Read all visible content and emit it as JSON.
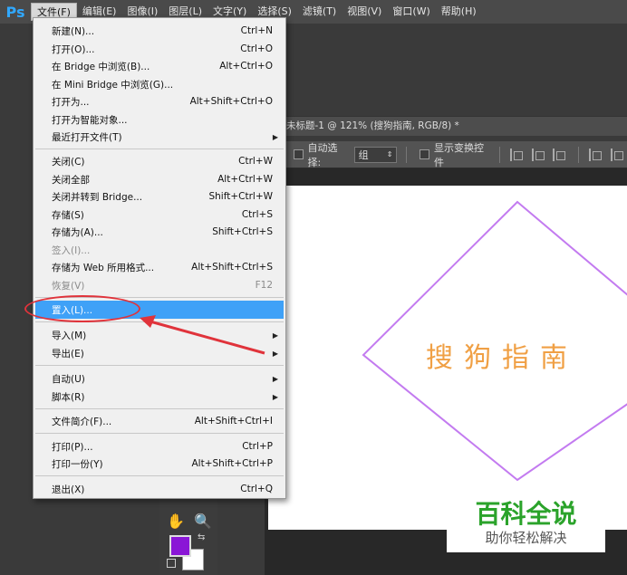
{
  "menubar": {
    "logo": "Ps",
    "items": [
      "文件(F)",
      "编辑(E)",
      "图像(I)",
      "图层(L)",
      "文字(Y)",
      "选择(S)",
      "滤镜(T)",
      "视图(V)",
      "窗口(W)",
      "帮助(H)"
    ]
  },
  "document": {
    "tab_title": "未标题-1 @ 121% (搜狗指南, RGB/8) *",
    "canvas_text": "搜狗指南"
  },
  "options": {
    "auto_select_label": "自动选择:",
    "auto_select_value": "组",
    "show_transform_label": "显示变换控件"
  },
  "file_menu": [
    {
      "label": "新建(N)...",
      "shortcut": "Ctrl+N"
    },
    {
      "label": "打开(O)...",
      "shortcut": "Ctrl+O"
    },
    {
      "label": "在 Bridge 中浏览(B)...",
      "shortcut": "Alt+Ctrl+O"
    },
    {
      "label": "在 Mini Bridge 中浏览(G)...",
      "shortcut": ""
    },
    {
      "label": "打开为...",
      "shortcut": "Alt+Shift+Ctrl+O"
    },
    {
      "label": "打开为智能对象...",
      "shortcut": ""
    },
    {
      "label": "最近打开文件(T)",
      "shortcut": "",
      "submenu": true
    },
    {
      "label": "关闭(C)",
      "shortcut": "Ctrl+W"
    },
    {
      "label": "关闭全部",
      "shortcut": "Alt+Ctrl+W"
    },
    {
      "label": "关闭并转到 Bridge...",
      "shortcut": "Shift+Ctrl+W"
    },
    {
      "label": "存储(S)",
      "shortcut": "Ctrl+S"
    },
    {
      "label": "存储为(A)...",
      "shortcut": "Shift+Ctrl+S"
    },
    {
      "label": "签入(I)...",
      "shortcut": "",
      "disabled": true
    },
    {
      "label": "存储为 Web 所用格式...",
      "shortcut": "Alt+Shift+Ctrl+S"
    },
    {
      "label": "恢复(V)",
      "shortcut": "F12",
      "disabled": true
    },
    {
      "label": "置入(L)...",
      "shortcut": "",
      "highlighted": true
    },
    {
      "label": "导入(M)",
      "shortcut": "",
      "submenu": true
    },
    {
      "label": "导出(E)",
      "shortcut": "",
      "submenu": true
    },
    {
      "label": "自动(U)",
      "shortcut": "",
      "submenu": true
    },
    {
      "label": "脚本(R)",
      "shortcut": "",
      "submenu": true
    },
    {
      "label": "文件简介(F)...",
      "shortcut": "Alt+Shift+Ctrl+I"
    },
    {
      "label": "打印(P)...",
      "shortcut": "Ctrl+P"
    },
    {
      "label": "打印一份(Y)",
      "shortcut": "Alt+Shift+Ctrl+P"
    },
    {
      "label": "退出(X)",
      "shortcut": "Ctrl+Q"
    }
  ],
  "colors": {
    "foreground": "#8a16d6",
    "background": "#ffffff",
    "highlight": "#3fa1f7",
    "annotation": "#e0333b",
    "diamond_stroke": "#c37bf0",
    "canvas_text": "#f0a045"
  },
  "watermark": {
    "title": "百科全说",
    "subtitle": "助你轻松解决"
  }
}
